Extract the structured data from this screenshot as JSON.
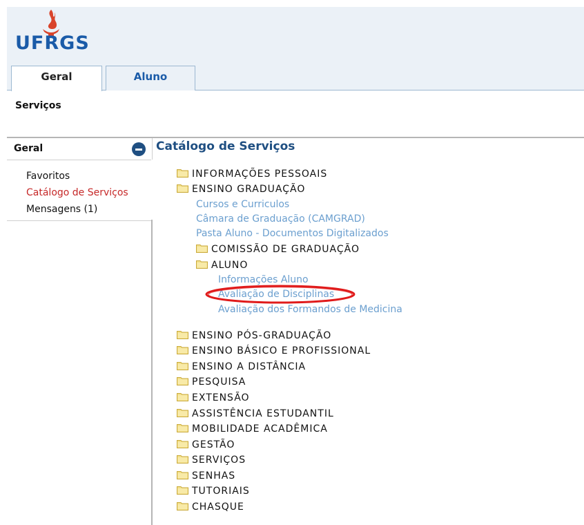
{
  "header": {
    "logo_text": "UFRGS",
    "tabs": [
      {
        "label": "Geral",
        "active": true
      },
      {
        "label": "Aluno",
        "active": false
      }
    ],
    "section_title": "Serviços"
  },
  "sidebar": {
    "title": "Geral",
    "items": [
      {
        "label": "Favoritos",
        "active": false
      },
      {
        "label": "Catálogo de Serviços",
        "active": true
      },
      {
        "label": "Mensagens (1)",
        "active": false
      }
    ]
  },
  "catalog": {
    "title": "Catálogo de Serviços",
    "tree": {
      "informacoes_pessoais": "INFORMAÇÕES PESSOAIS",
      "ensino_graduacao": "ENSINO GRADUAÇÃO",
      "cursos": "Cursos e Curriculos",
      "camara": "Câmara de Graduação (CAMGRAD)",
      "pasta": "Pasta Aluno - Documentos Digitalizados",
      "comissao": "COMISSÃO DE GRADUAÇÃO",
      "aluno": "ALUNO",
      "info_aluno": "Informações Aluno",
      "avaliacao_disciplinas": "Avaliação de Disciplinas",
      "avaliacao_formandos": "Avaliação dos Formandos de Medicina",
      "pos_graduacao": "ENSINO PÓS-GRADUAÇÃO",
      "basico": "ENSINO BÁSICO E PROFISSIONAL",
      "distancia": "ENSINO A DISTÂNCIA",
      "pesquisa": "PESQUISA",
      "extensao": "EXTENSÃO",
      "assistencia": "ASSISTÊNCIA ESTUDANTIL",
      "mobilidade": "MOBILIDADE ACADÊMICA",
      "gestao": "GESTÃO",
      "servicos": "SERVIÇOS",
      "senhas": "SENHAS",
      "tutoriais": "TUTORIAIS",
      "chasque": "CHASQUE"
    }
  },
  "colors": {
    "brand_blue": "#1a5ba8",
    "header_bg": "#ebf1f7",
    "link_blue": "#6b9fcf",
    "active_red": "#c62828",
    "logo_red": "#d9442b",
    "annotation_red": "#e01b1b",
    "folder_yellow": "#f3e08a"
  },
  "icons": {
    "logo": "ufrgs-flame-logo",
    "collapse": "minus-circle-icon",
    "folder": "folder-icon"
  }
}
